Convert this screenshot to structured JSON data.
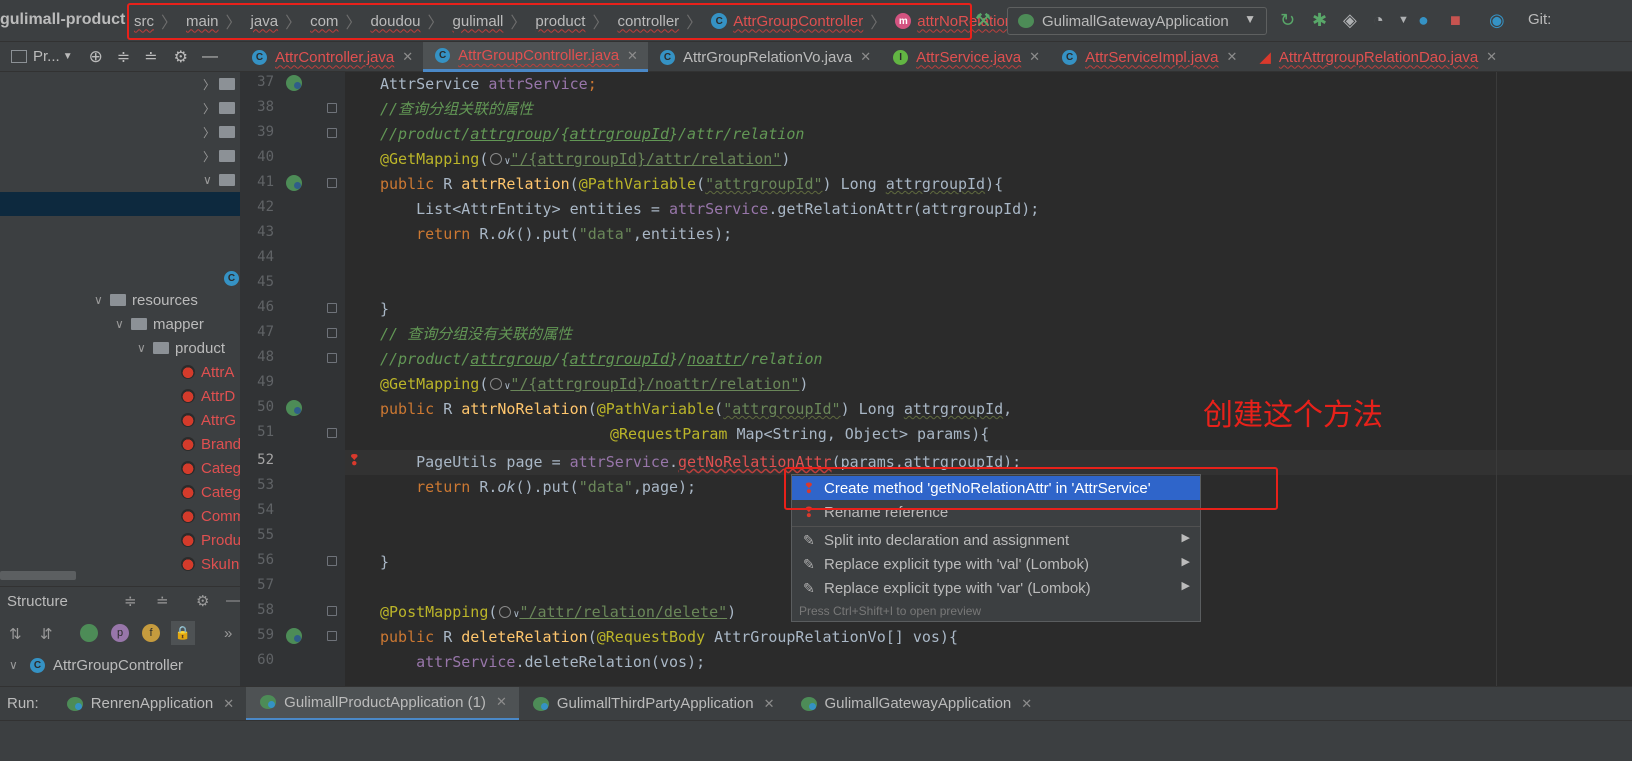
{
  "navbar": {
    "project": "gulimall-product",
    "crumbs": [
      "src",
      "main",
      "java",
      "com",
      "doudou",
      "gulimall",
      "product",
      "controller"
    ],
    "crumb_class": "AttrGroupController",
    "crumb_method": "attrNoRelation",
    "run_config": "GulimallGatewayApplication",
    "git_label": "Git:"
  },
  "project_panel": {
    "title": "Pr..."
  },
  "tabs": [
    {
      "label": "AttrController.java",
      "icon": "C"
    },
    {
      "label": "AttrGroupController.java",
      "icon": "C"
    },
    {
      "label": "AttrGroupRelationVo.java",
      "icon": "C"
    },
    {
      "label": "AttrService.java",
      "icon": "I"
    },
    {
      "label": "AttrServiceImpl.java",
      "icon": "C"
    },
    {
      "label": "AttrAttrgroupRelationDao.java",
      "icon": "dao"
    }
  ],
  "tree": {
    "resources": "resources",
    "mapper": "mapper",
    "product": "product",
    "files": [
      "AttrA",
      "AttrD",
      "AttrG",
      "Brand",
      "Categ",
      "Categ",
      "Comm",
      "Produ",
      "SkuIn"
    ]
  },
  "structure": {
    "title": "Structure",
    "root": "AttrGroupController"
  },
  "editor": {
    "current_line": 52,
    "line_numbers": [
      37,
      38,
      39,
      40,
      41,
      42,
      43,
      44,
      45,
      46,
      47,
      48,
      49,
      50,
      51,
      52,
      53,
      54,
      55,
      56,
      57,
      58,
      59,
      60
    ]
  },
  "code": {
    "l37": [
      "AttrService ",
      "attrService",
      ";"
    ],
    "l38": "//查询分组关联的属性",
    "l39": [
      "//product/",
      "attrgroup",
      "/{",
      "attrgroupId",
      "}/attr/relation"
    ],
    "l40": [
      "@GetMapping",
      "(",
      "\"/{attrgroupId}/attr/relation\"",
      ")"
    ],
    "l41": [
      "public ",
      "R ",
      "attrRelation",
      "(",
      "@PathVariable",
      "(",
      "\"attrgroupId\"",
      ") Long ",
      "attrgroupId",
      "){"
    ],
    "l42": [
      "List<AttrEntity> entities = ",
      "attrService",
      ".getRelationAttr(attrgroupId);"
    ],
    "l43": [
      "return ",
      "R.",
      "ok",
      "().put(",
      "\"data\"",
      ",entities);"
    ],
    "l46": "}",
    "l47": "// 查询分组没有关联的属性",
    "l48": [
      "//product/",
      "attrgroup",
      "/{",
      "attrgroupId",
      "}/",
      "noattr",
      "/relation"
    ],
    "l49": [
      "@GetMapping",
      "(",
      "\"/{attrgroupId}/noattr/relation\"",
      ")"
    ],
    "l50": [
      "public ",
      "R ",
      "attrNoRelation",
      "(",
      "@PathVariable",
      "(",
      "\"attrgroupId\"",
      ") Long ",
      "attrgroupId",
      ","
    ],
    "l51": [
      "@RequestParam ",
      "Map<String, Object> params){"
    ],
    "l52": [
      "PageUtils page = ",
      "attrService",
      ".",
      "getNoRelationAttr",
      "(params,attrgroupId);"
    ],
    "l53": [
      "return ",
      "R.",
      "ok",
      "().put(",
      "\"data\"",
      ",page);"
    ],
    "l56": "}",
    "l58": [
      "@PostMapping",
      "(",
      "\"/attr/relation/delete\"",
      ")"
    ],
    "l59": [
      "public ",
      "R ",
      "deleteRelation",
      "(",
      "@RequestBody ",
      "AttrGroupRelationVo[] vos){"
    ],
    "l60": [
      "attrService",
      ".deleteRelation(vos);"
    ]
  },
  "annotation": "创建这个方法",
  "popup": {
    "items": [
      {
        "label": "Create method 'getNoRelationAttr' in 'AttrService'",
        "selected": true
      },
      {
        "label": "Rename reference",
        "selected": false
      },
      {
        "label": "Split into declaration and assignment",
        "selected": false
      },
      {
        "label": "Replace explicit type with 'val' (Lombok)",
        "selected": false
      },
      {
        "label": "Replace explicit type with 'var' (Lombok)",
        "selected": false
      }
    ],
    "hint": "Press Ctrl+Shift+I to open preview"
  },
  "runbar": {
    "label": "Run:",
    "tabs": [
      {
        "label": "RenrenApplication"
      },
      {
        "label": "GulimallProductApplication (1)"
      },
      {
        "label": "GulimallThirdPartyApplication"
      },
      {
        "label": "GulimallGatewayApplication"
      }
    ]
  },
  "colors": {
    "highlight_red": "#e8211a",
    "selection_blue": "#2f65ca",
    "editor_bg": "#2b2b2b",
    "panel_bg": "#3c3f41"
  }
}
